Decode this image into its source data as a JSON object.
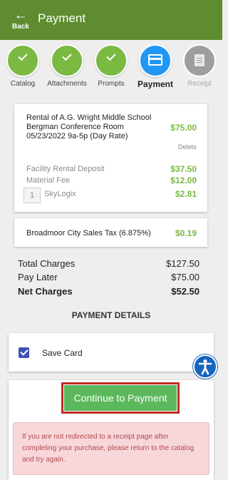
{
  "header": {
    "back_arrow": "←",
    "back_label": "Back",
    "title": "Payment"
  },
  "steps": [
    {
      "label": "Catalog",
      "state": "done"
    },
    {
      "label": "Attachments",
      "state": "done"
    },
    {
      "label": "Prompts",
      "state": "done"
    },
    {
      "label": "Payment",
      "state": "active"
    },
    {
      "label": "Receipt",
      "state": "pending"
    }
  ],
  "cart": {
    "item_description": "Rental of A.G. Wright Middle School Bergman Conference Room 05/23/2022 9a-5p (Day Rate)",
    "item_price": "$75.00",
    "delete_label": "Delete",
    "fees": [
      {
        "label": "Facility Rental Deposit",
        "amount": "$37.50"
      },
      {
        "label": "Material Fee",
        "amount": "$12.00"
      },
      {
        "label": "SkyLogix",
        "amount": "$2.81",
        "quantity": "1"
      }
    ]
  },
  "tax": {
    "label": "Broadmoor City Sales Tax (6.875%)",
    "amount": "$0.19"
  },
  "totals": {
    "total_charges_label": "Total Charges",
    "total_charges": "$127.50",
    "pay_later_label": "Pay Later",
    "pay_later": "$75.00",
    "net_charges_label": "Net Charges",
    "net_charges": "$52.50"
  },
  "payment_details": {
    "heading": "PAYMENT DETAILS",
    "save_card_label": "Save Card",
    "save_card_checked": true
  },
  "actions": {
    "continue_label": "Continue to Payment"
  },
  "alert": {
    "message": "If you are not redirected to a receipt page after completing your purchase, please return to the catalog and try again."
  },
  "colors": {
    "header": "#5e8c2f",
    "done": "#7ab942",
    "active": "#2196f3",
    "pending": "#9e9e9e",
    "price": "#7ab942",
    "button": "#5cb85c",
    "alert_bg": "#f8d7da"
  },
  "icons": {
    "back": "arrow-left-icon",
    "done": "check-icon",
    "active": "credit-card-icon",
    "pending": "receipt-icon",
    "accessibility": "accessibility-icon"
  }
}
